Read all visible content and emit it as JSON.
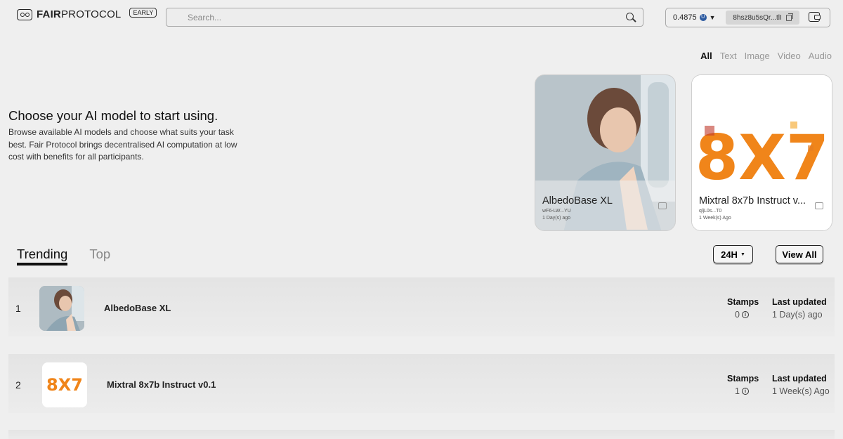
{
  "brand": {
    "name_bold": "FAIR",
    "name_regular": "PROTOCOL",
    "badge": "EARLY"
  },
  "search": {
    "placeholder": "Search..."
  },
  "wallet": {
    "balance": "0.4875",
    "address": "8hsz8u5sQr...tlI"
  },
  "filters": [
    {
      "label": "All",
      "active": true
    },
    {
      "label": "Text",
      "active": false
    },
    {
      "label": "Image",
      "active": false
    },
    {
      "label": "Video",
      "active": false
    },
    {
      "label": "Audio",
      "active": false
    }
  ],
  "hero": {
    "title": "Choose your AI model to start using.",
    "description": "Browse available AI models and choose what suits your task best. Fair Protocol brings decentralised AI computation at low cost with benefits for all participants."
  },
  "featured": [
    {
      "title": "AlbedoBase XL",
      "owner": "wF6-LW...YU",
      "time": "1 Day(s) ago"
    },
    {
      "title": "Mixtral 8x7b Instruct v...",
      "owner": "qljL0s...T0",
      "time": "1 Week(s) Ago",
      "art_text": "8X7"
    }
  ],
  "tabs": {
    "trending": "Trending",
    "top": "Top"
  },
  "controls": {
    "period": "24H",
    "view_all": "View All"
  },
  "table": {
    "col_stamps": "Stamps",
    "col_updated": "Last updated",
    "rows": [
      {
        "rank": "1",
        "name": "AlbedoBase XL",
        "stamps": "0",
        "updated": "1 Day(s) ago"
      },
      {
        "rank": "2",
        "name": "Mixtral 8x7b Instruct v0.1",
        "stamps": "1",
        "updated": "1 Week(s) Ago",
        "art_text": "8X7"
      }
    ]
  },
  "colors": {
    "background": "#efefef",
    "accent": "#111111",
    "muted": "#999999",
    "token": "#2c5aa0",
    "art_orange": "#f0851a"
  }
}
